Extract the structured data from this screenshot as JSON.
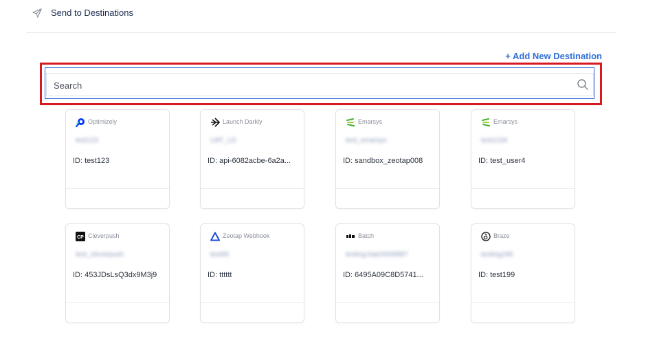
{
  "header": {
    "icon": "send-icon",
    "title": "Send to Destinations"
  },
  "actions": {
    "add_destination": "+ Add New Destination"
  },
  "search": {
    "placeholder": "Search",
    "value": "",
    "icon": "search-icon"
  },
  "colors": {
    "accent": "#2f6fd6",
    "highlight_border": "#d71920",
    "focus_border": "#2d62d8"
  },
  "destinations": [
    {
      "type": "Optimizely",
      "icon": "optimizely-icon",
      "name": "test123",
      "id": "ID: test123"
    },
    {
      "type": "Launch Darkly",
      "icon": "launchdarkly-icon",
      "name": "UAT_LD",
      "id": "ID: api-6082acbe-6a2a..."
    },
    {
      "type": "Emarsys",
      "icon": "emarsys-icon",
      "name": "test_emarsys",
      "id": "ID: sandbox_zeotap008"
    },
    {
      "type": "Emarsys",
      "icon": "emarsys-icon",
      "name": "test1234",
      "id": "ID: test_user4"
    },
    {
      "type": "Cleverpush",
      "icon": "cleverpush-icon",
      "name": "test_cleverpush",
      "id": "ID: 453JDsLsQ3dx9M3j9"
    },
    {
      "type": "Zeotap Webhook",
      "icon": "zeotap-webhook-icon",
      "name": "test66",
      "id": "ID: tttttt"
    },
    {
      "type": "Batch",
      "icon": "batch-icon",
      "name": "testing-batch009987",
      "id": "ID: 6495A09C8D5741..."
    },
    {
      "type": "Braze",
      "icon": "braze-icon",
      "name": "testing199",
      "id": "ID: test199"
    }
  ]
}
